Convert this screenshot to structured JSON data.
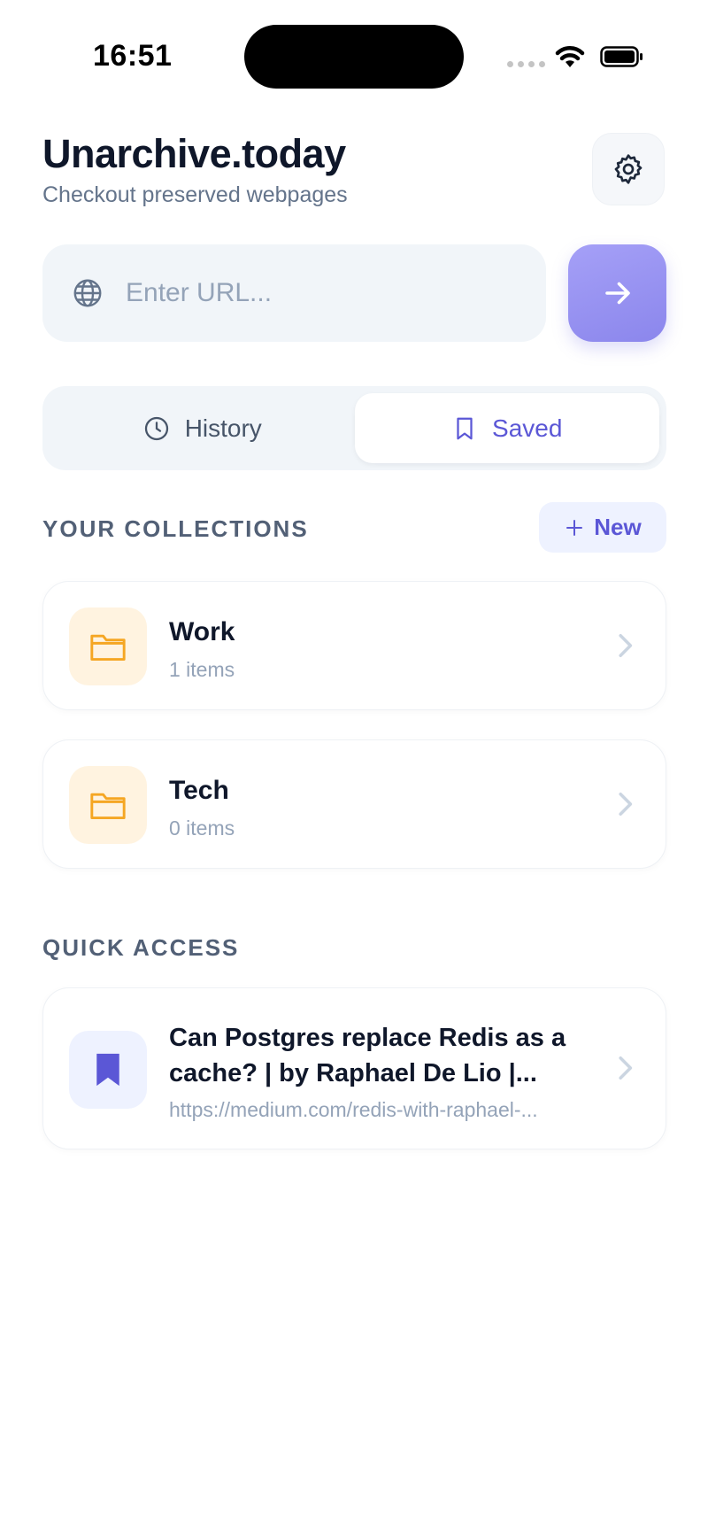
{
  "status_bar": {
    "time": "16:51"
  },
  "header": {
    "title": "Unarchive.today",
    "subtitle": "Checkout preserved webpages"
  },
  "search": {
    "placeholder": "Enter URL...",
    "value": ""
  },
  "tabs": [
    {
      "label": "History",
      "icon": "clock-icon",
      "selected": false
    },
    {
      "label": "Saved",
      "icon": "bookmark-icon",
      "selected": true
    }
  ],
  "collections": {
    "heading": "YOUR COLLECTIONS",
    "new_label": "New",
    "items": [
      {
        "name": "Work",
        "count": "1 items",
        "icon": "folder-icon"
      },
      {
        "name": "Tech",
        "count": "0 items",
        "icon": "folder-icon"
      }
    ]
  },
  "quick_access": {
    "heading": "QUICK ACCESS",
    "items": [
      {
        "title": "Can Postgres replace Redis as a cache? | by Raphael De Lio |...",
        "url": "https://medium.com/redis-with-raphael-...",
        "icon": "bookmark-filled-icon"
      }
    ]
  },
  "colors": {
    "accent": "#5b57d6",
    "go_button": "#9a95f2",
    "folder_tile": "#fff3e0",
    "folder_icon": "#f5a623",
    "bookmark_tile": "#eef2ff",
    "bookmark_icon": "#5b57d6"
  }
}
